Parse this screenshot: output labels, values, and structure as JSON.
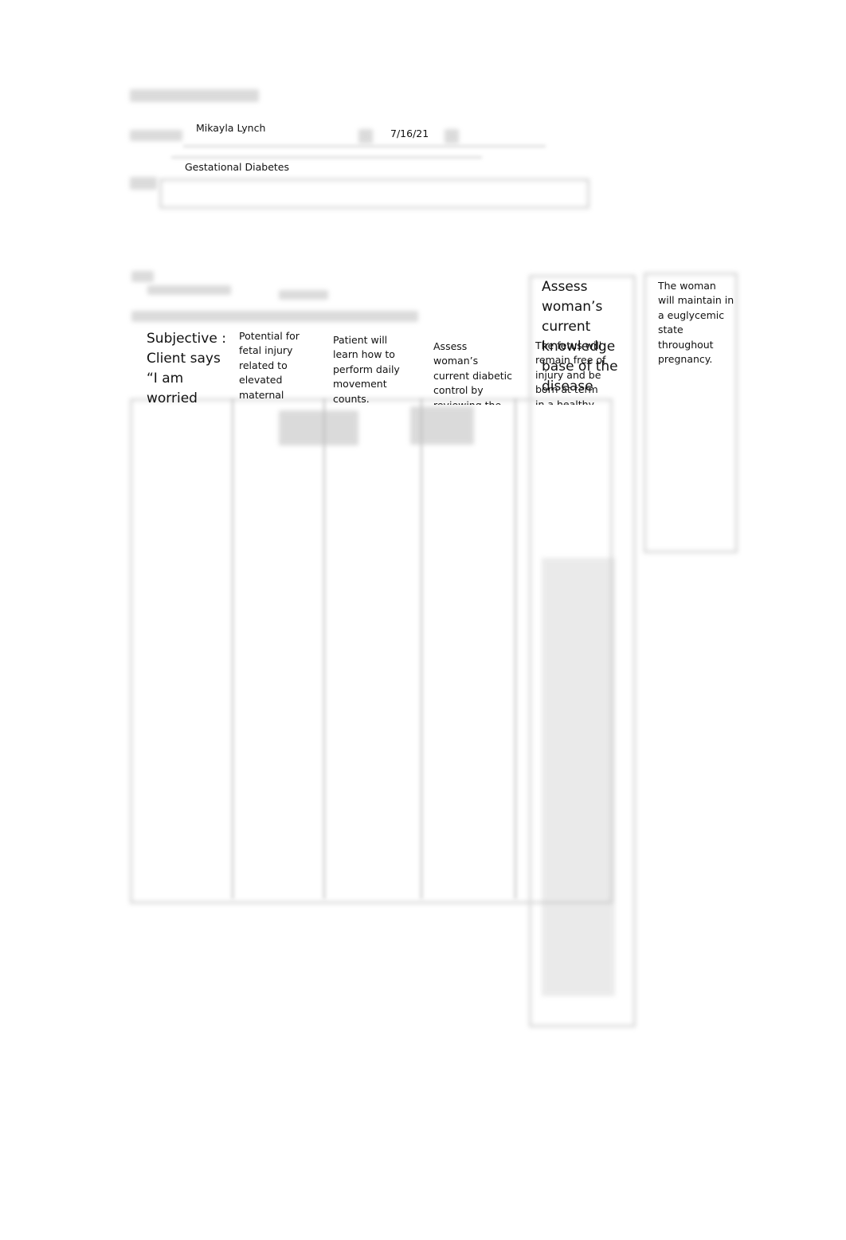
{
  "header": {
    "student_name": "Mikayla Lynch",
    "date": "7/16/21",
    "diagnosis": "Gestational Diabetes"
  },
  "care_plan": {
    "assessment": "Subjective : Client says “I am worried",
    "nursing_diagnosis": "Potential for fetal injury related to elevated maternal",
    "goal": "Patient will learn how to perform daily movement counts.",
    "intervention": "Assess woman’s current diabetic control by reviewing the blood glucose",
    "outcome_fetus": "The fetus will remain free of injury and be born at term in a healthy",
    "intervention_2": "Assess woman’s current knowledge base of the disease",
    "outcome_woman": "The woman will maintain in a euglycemic state throughout pregnancy."
  }
}
